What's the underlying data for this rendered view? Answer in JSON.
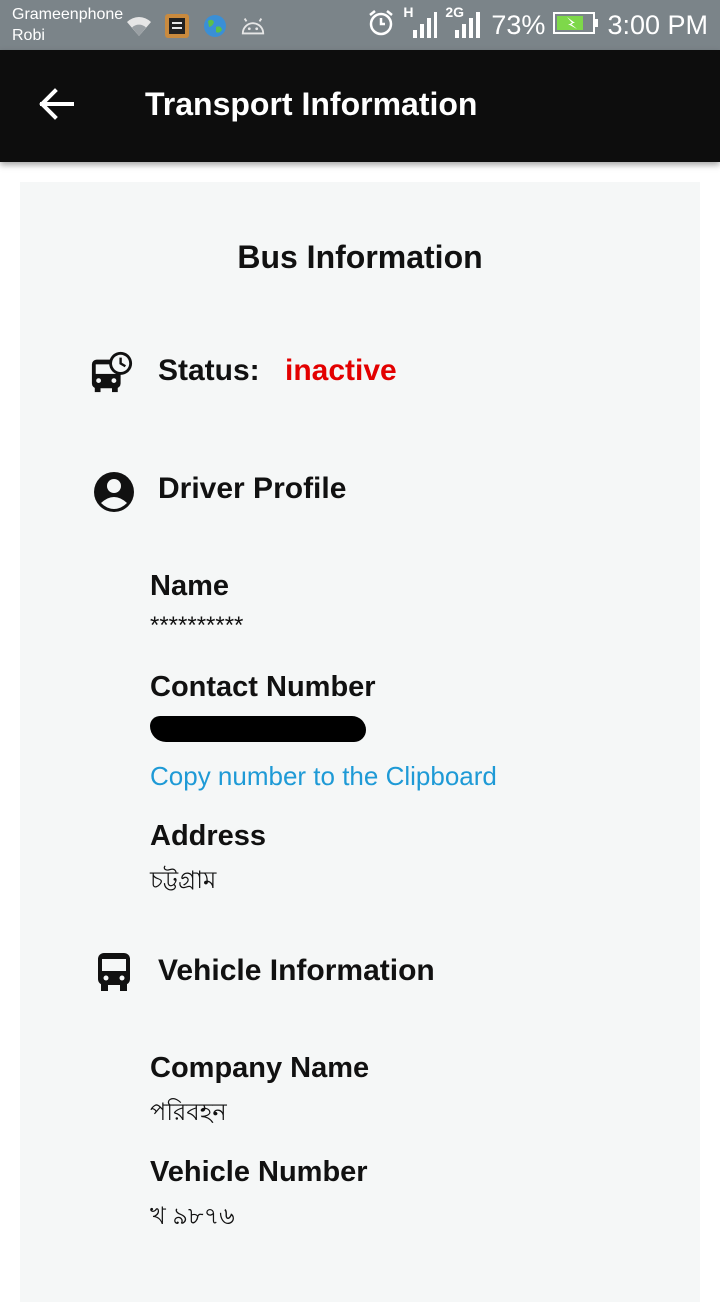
{
  "status_bar": {
    "carrier_1": "Grameenphone",
    "carrier_2": "Robi",
    "left_icons": [
      "wifi-icon",
      "app-notification-icon",
      "globe-icon",
      "android-icon"
    ],
    "right_icons": [
      "alarm-icon",
      "signal-h-icon",
      "signal-2g-icon",
      "battery-charging-icon"
    ],
    "network_1": "H",
    "network_2": "2G",
    "battery": "73%",
    "time": "3:00 PM"
  },
  "app_bar": {
    "back_icon": "arrow-back-icon",
    "title": "Transport Information"
  },
  "card": {
    "title": "Bus Information",
    "status": {
      "icon": "bus-clock-icon",
      "label": "Status:",
      "value": "inactive",
      "value_color": "#e30000"
    },
    "driver_profile": {
      "icon": "account-circle-icon",
      "heading": "Driver Profile",
      "name_label": "Name",
      "name_value": "**********",
      "contact_label": "Contact Number",
      "copy_link": "Copy number to the Clipboard",
      "address_label": "Address",
      "address_value": "চট্টগ্রাম"
    },
    "vehicle_info": {
      "icon": "bus-icon",
      "heading": "Vehicle Information",
      "company_label": "Company Name",
      "company_value": "পরিবহন",
      "vehicle_number_label": "Vehicle Number",
      "vehicle_number_value": "খ ৯৮৭৬"
    }
  },
  "colors": {
    "status_bar": "#7b8489",
    "app_bar": "#0d0d0d",
    "card_bg": "#f5f7f7",
    "link": "#1e9ad6"
  }
}
